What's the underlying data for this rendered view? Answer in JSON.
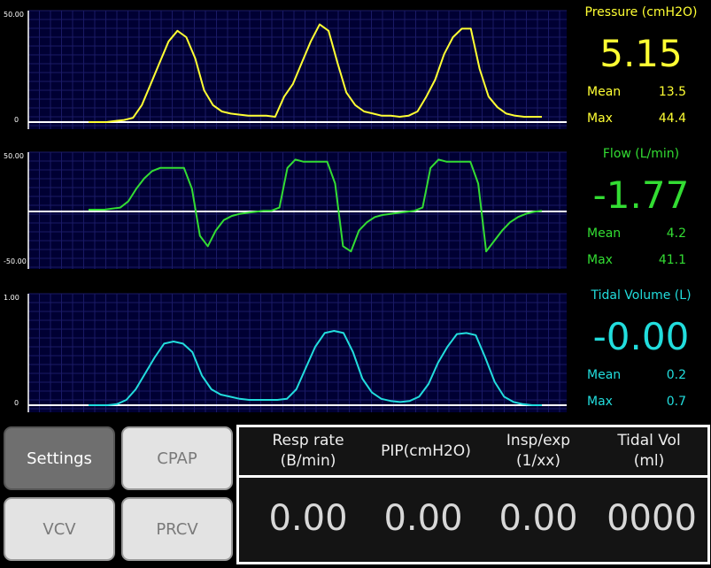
{
  "charts": [
    {
      "y_top_label": "50.00",
      "y_bottom_label": "0",
      "color": "#ffff33",
      "values": [
        0,
        0,
        0,
        0.5,
        1,
        2,
        8,
        18,
        28,
        38,
        43,
        40,
        30,
        15,
        8,
        5,
        4,
        3.5,
        3,
        3,
        3,
        2.5,
        12,
        18,
        28,
        38,
        46,
        43,
        28,
        14,
        8,
        5,
        4,
        3,
        3,
        2.5,
        3,
        5,
        12,
        20,
        32,
        40,
        44,
        44,
        25,
        12,
        7,
        4,
        3,
        2.5,
        2.5,
        2.5
      ]
    },
    {
      "y_top_label": "50.00",
      "y_bottom_label": "-50.00",
      "color": "#33dd33",
      "values": [
        0,
        0,
        0,
        1,
        2,
        8,
        20,
        30,
        37,
        40,
        40,
        40,
        40,
        20,
        -25,
        -35,
        -20,
        -10,
        -6,
        -4,
        -3,
        -2,
        -1,
        -1,
        2,
        40,
        48,
        46,
        46,
        46,
        46,
        25,
        -35,
        -40,
        -20,
        -12,
        -7,
        -5,
        -4,
        -3,
        -2,
        -1,
        2,
        40,
        48,
        46,
        46,
        46,
        46,
        25,
        -40,
        -30,
        -20,
        -12,
        -7,
        -4,
        -2,
        -1
      ]
    },
    {
      "y_top_label": "1.00",
      "y_bottom_label": "0",
      "color": "#22dddd",
      "values": [
        0,
        0,
        0,
        0.01,
        0.05,
        0.15,
        0.3,
        0.45,
        0.58,
        0.6,
        0.58,
        0.5,
        0.28,
        0.15,
        0.1,
        0.08,
        0.06,
        0.05,
        0.05,
        0.05,
        0.05,
        0.06,
        0.15,
        0.35,
        0.55,
        0.68,
        0.7,
        0.68,
        0.5,
        0.25,
        0.12,
        0.06,
        0.04,
        0.03,
        0.04,
        0.08,
        0.2,
        0.4,
        0.55,
        0.67,
        0.68,
        0.66,
        0.45,
        0.22,
        0.08,
        0.03,
        0.01,
        0,
        0
      ]
    }
  ],
  "pressure": {
    "title": "Pressure (cmH2O)",
    "value": "5.15",
    "mean_label": "Mean",
    "mean": "13.5",
    "max_label": "Max",
    "max": "44.4"
  },
  "flow": {
    "title": "Flow (L/min)",
    "value": "-1.77",
    "mean_label": "Mean",
    "mean": "4.2",
    "max_label": "Max",
    "max": "41.1"
  },
  "tidal": {
    "title": "Tidal Volume (L)",
    "value": "-0.00",
    "mean_label": "Mean",
    "mean": "0.2",
    "max_label": "Max",
    "max": "0.7"
  },
  "buttons": {
    "settings": "Settings",
    "cpap": "CPAP",
    "vcv": "VCV",
    "prcv": "PRCV"
  },
  "params": {
    "resp_rate_label": "Resp rate",
    "resp_rate_unit": "(B/min)",
    "resp_rate": "0.00",
    "pip_label": "PIP(cmH2O)",
    "pip": "0.00",
    "ie_label": "Insp/exp",
    "ie_unit": "(1/xx)",
    "ie": "0.00",
    "tidal_label": "Tidal Vol",
    "tidal_unit": "(ml)",
    "tidal": "0000"
  }
}
